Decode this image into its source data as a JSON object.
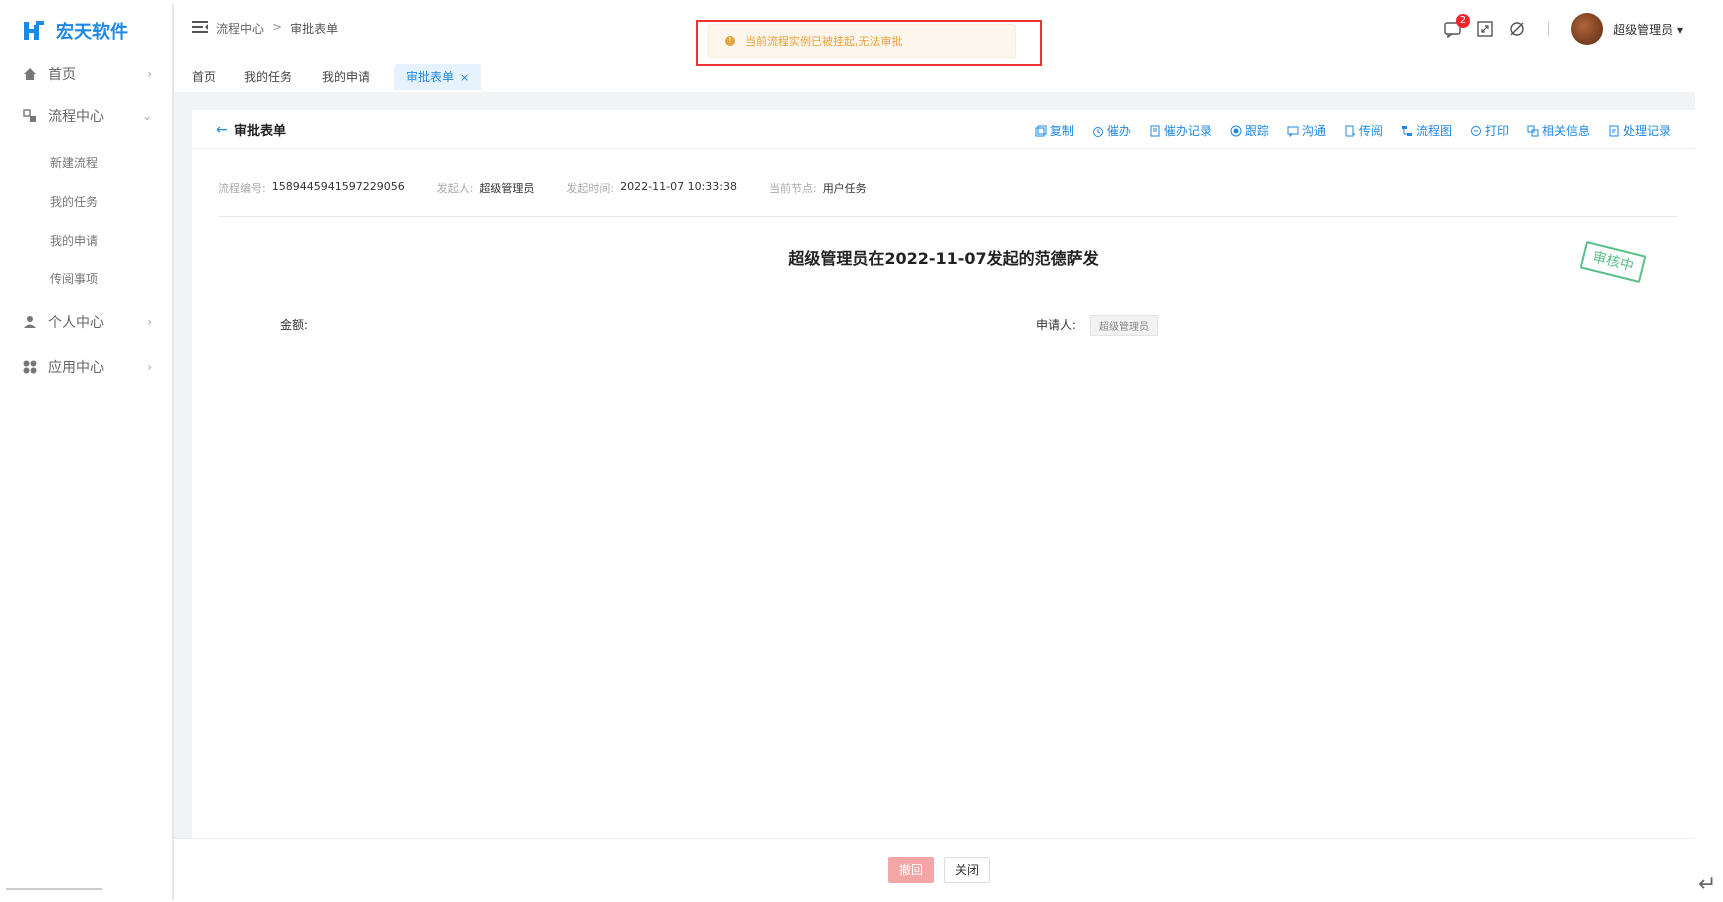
{
  "brand": {
    "name": "宏天软件"
  },
  "sidebar": {
    "menu": [
      {
        "label": "首页",
        "icon": "home-icon"
      },
      {
        "label": "流程中心",
        "icon": "flow-icon"
      },
      {
        "label": "个人中心",
        "icon": "user-icon"
      },
      {
        "label": "应用中心",
        "icon": "apps-icon"
      }
    ],
    "submenu": [
      "新建流程",
      "我的任务",
      "我的申请",
      "传阅事项"
    ]
  },
  "header": {
    "breadcrumb": [
      "流程中心",
      "审批表单"
    ],
    "breadcrumb_sep": ">",
    "notification_count": "2",
    "user_name": "超级管理员"
  },
  "tabs": [
    {
      "label": "首页"
    },
    {
      "label": "我的任务"
    },
    {
      "label": "我的申请"
    },
    {
      "label": "审批表单",
      "close": "×"
    }
  ],
  "alert": {
    "message": "当前流程实例已被挂起,无法审批"
  },
  "card": {
    "title": "审批表单",
    "toolbar": [
      "复制",
      "催办",
      "催办记录",
      "跟踪",
      "沟通",
      "传阅",
      "流程图",
      "打印",
      "相关信息",
      "处理记录"
    ],
    "meta": [
      {
        "key": "流程编号:",
        "value": "1589445941597229056"
      },
      {
        "key": "发起人:",
        "value": "超级管理员"
      },
      {
        "key": "发起时间:",
        "value": "2022-11-07 10:33:38"
      },
      {
        "key": "当前节点:",
        "value": "用户任务"
      }
    ],
    "form_title": "超级管理员在2022-11-07发起的范德萨发",
    "stamp": "审核中",
    "fields": {
      "amount_label": "金额:",
      "applicant_label": "申请人:",
      "applicant_value": "超级管理员"
    }
  },
  "footer": {
    "withdraw": "撤回",
    "close": "关闭"
  },
  "colors": {
    "accent": "#1e88e5",
    "warning": "#e6a23c",
    "stamp": "#5bbf8a"
  }
}
